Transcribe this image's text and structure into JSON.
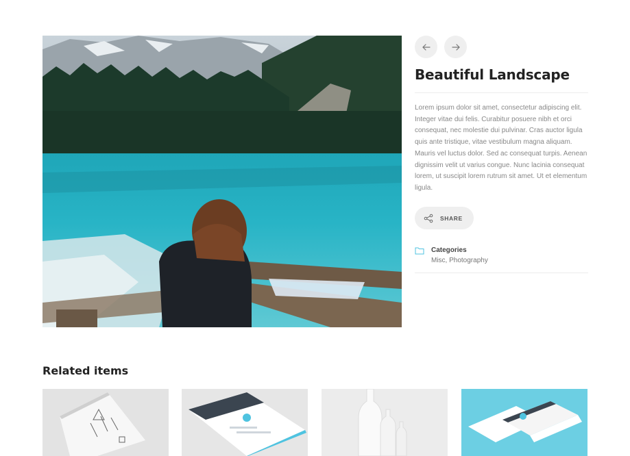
{
  "portfolio": {
    "title": "Beautiful Landscape",
    "description": "Lorem ipsum dolor sit amet, consectetur adipiscing elit. Integer vitae dui felis. Curabitur posuere nibh et orci consequat, nec molestie dui pulvinar. Cras auctor ligula quis ante tristique, vitae vestibulum magna aliquam. Mauris vel luctus dolor. Sed ac consequat turpis. Aenean dignissim velit ut varius congue. Nunc lacinia consequat lorem, ut suscipit lorem rutrum sit amet. Ut et elementum ligula.",
    "share_label": "SHARE",
    "categories_label": "Categories",
    "categories_value": "Misc, Photography"
  },
  "navigation": {
    "prev_icon": "arrow-left-icon",
    "next_icon": "arrow-right-icon"
  },
  "related": {
    "title": "Related items",
    "items": [
      {
        "image": "sketchbook-mockup"
      },
      {
        "image": "website-mockup"
      },
      {
        "image": "bottles-mockup"
      },
      {
        "image": "webpages-mockup"
      }
    ]
  },
  "colors": {
    "accent": "#4fc3e0",
    "heading": "#222222",
    "text": "#888888",
    "button_bg": "#efefef"
  }
}
